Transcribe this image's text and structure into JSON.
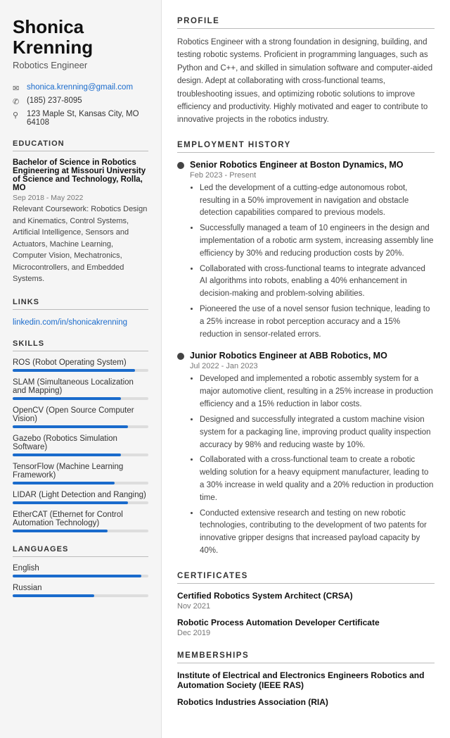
{
  "sidebar": {
    "name": "Shonica\nKrenning",
    "name_line1": "Shonica",
    "name_line2": "Krenning",
    "job_title": "Robotics Engineer",
    "contact": {
      "email": "shonica.krenning@gmail.com",
      "phone": "(185) 237-8095",
      "address": "123 Maple St, Kansas City, MO 64108"
    },
    "education_title": "Education",
    "education": {
      "degree": "Bachelor of Science in Robotics Engineering at Missouri University of Science and Technology, Rolla, MO",
      "date": "Sep 2018 - May 2022",
      "courses": "Relevant Coursework: Robotics Design and Kinematics, Control Systems, Artificial Intelligence, Sensors and Actuators, Machine Learning, Computer Vision, Mechatronics, Microcontrollers, and Embedded Systems."
    },
    "links_title": "Links",
    "links": [
      {
        "label": "linkedin.com/in/shonicakrenning",
        "url": "#"
      }
    ],
    "skills_title": "Skills",
    "skills": [
      {
        "name": "ROS (Robot Operating System)",
        "pct": 90
      },
      {
        "name": "SLAM (Simultaneous Localization and Mapping)",
        "pct": 80
      },
      {
        "name": "OpenCV (Open Source Computer Vision)",
        "pct": 85
      },
      {
        "name": "Gazebo (Robotics Simulation Software)",
        "pct": 80
      },
      {
        "name": "TensorFlow (Machine Learning Framework)",
        "pct": 75
      },
      {
        "name": "LIDAR (Light Detection and Ranging)",
        "pct": 85
      },
      {
        "name": "EtherCAT (Ethernet for Control Automation Technology)",
        "pct": 70
      }
    ],
    "languages_title": "Languages",
    "languages": [
      {
        "name": "English",
        "pct": 95
      },
      {
        "name": "Russian",
        "pct": 60
      }
    ]
  },
  "main": {
    "profile_title": "Profile",
    "profile_text": "Robotics Engineer with a strong foundation in designing, building, and testing robotic systems. Proficient in programming languages, such as Python and C++, and skilled in simulation software and computer-aided design. Adept at collaborating with cross-functional teams, troubleshooting issues, and optimizing robotic solutions to improve efficiency and productivity. Highly motivated and eager to contribute to innovative projects in the robotics industry.",
    "employment_title": "Employment History",
    "jobs": [
      {
        "title": "Senior Robotics Engineer at Boston Dynamics, MO",
        "date": "Feb 2023 - Present",
        "bullets": [
          "Led the development of a cutting-edge autonomous robot, resulting in a 50% improvement in navigation and obstacle detection capabilities compared to previous models.",
          "Successfully managed a team of 10 engineers in the design and implementation of a robotic arm system, increasing assembly line efficiency by 30% and reducing production costs by 20%.",
          "Collaborated with cross-functional teams to integrate advanced AI algorithms into robots, enabling a 40% enhancement in decision-making and problem-solving abilities.",
          "Pioneered the use of a novel sensor fusion technique, leading to a 25% increase in robot perception accuracy and a 15% reduction in sensor-related errors."
        ]
      },
      {
        "title": "Junior Robotics Engineer at ABB Robotics, MO",
        "date": "Jul 2022 - Jan 2023",
        "bullets": [
          "Developed and implemented a robotic assembly system for a major automotive client, resulting in a 25% increase in production efficiency and a 15% reduction in labor costs.",
          "Designed and successfully integrated a custom machine vision system for a packaging line, improving product quality inspection accuracy by 98% and reducing waste by 10%.",
          "Collaborated with a cross-functional team to create a robotic welding solution for a heavy equipment manufacturer, leading to a 30% increase in weld quality and a 20% reduction in production time.",
          "Conducted extensive research and testing on new robotic technologies, contributing to the development of two patents for innovative gripper designs that increased payload capacity by 40%."
        ]
      }
    ],
    "certificates_title": "Certificates",
    "certificates": [
      {
        "name": "Certified Robotics System Architect (CRSA)",
        "date": "Nov 2021"
      },
      {
        "name": "Robotic Process Automation Developer Certificate",
        "date": "Dec 2019"
      }
    ],
    "memberships_title": "Memberships",
    "memberships": [
      {
        "name": "Institute of Electrical and Electronics Engineers Robotics and Automation Society (IEEE RAS)"
      },
      {
        "name": "Robotics Industries Association (RIA)"
      }
    ]
  }
}
